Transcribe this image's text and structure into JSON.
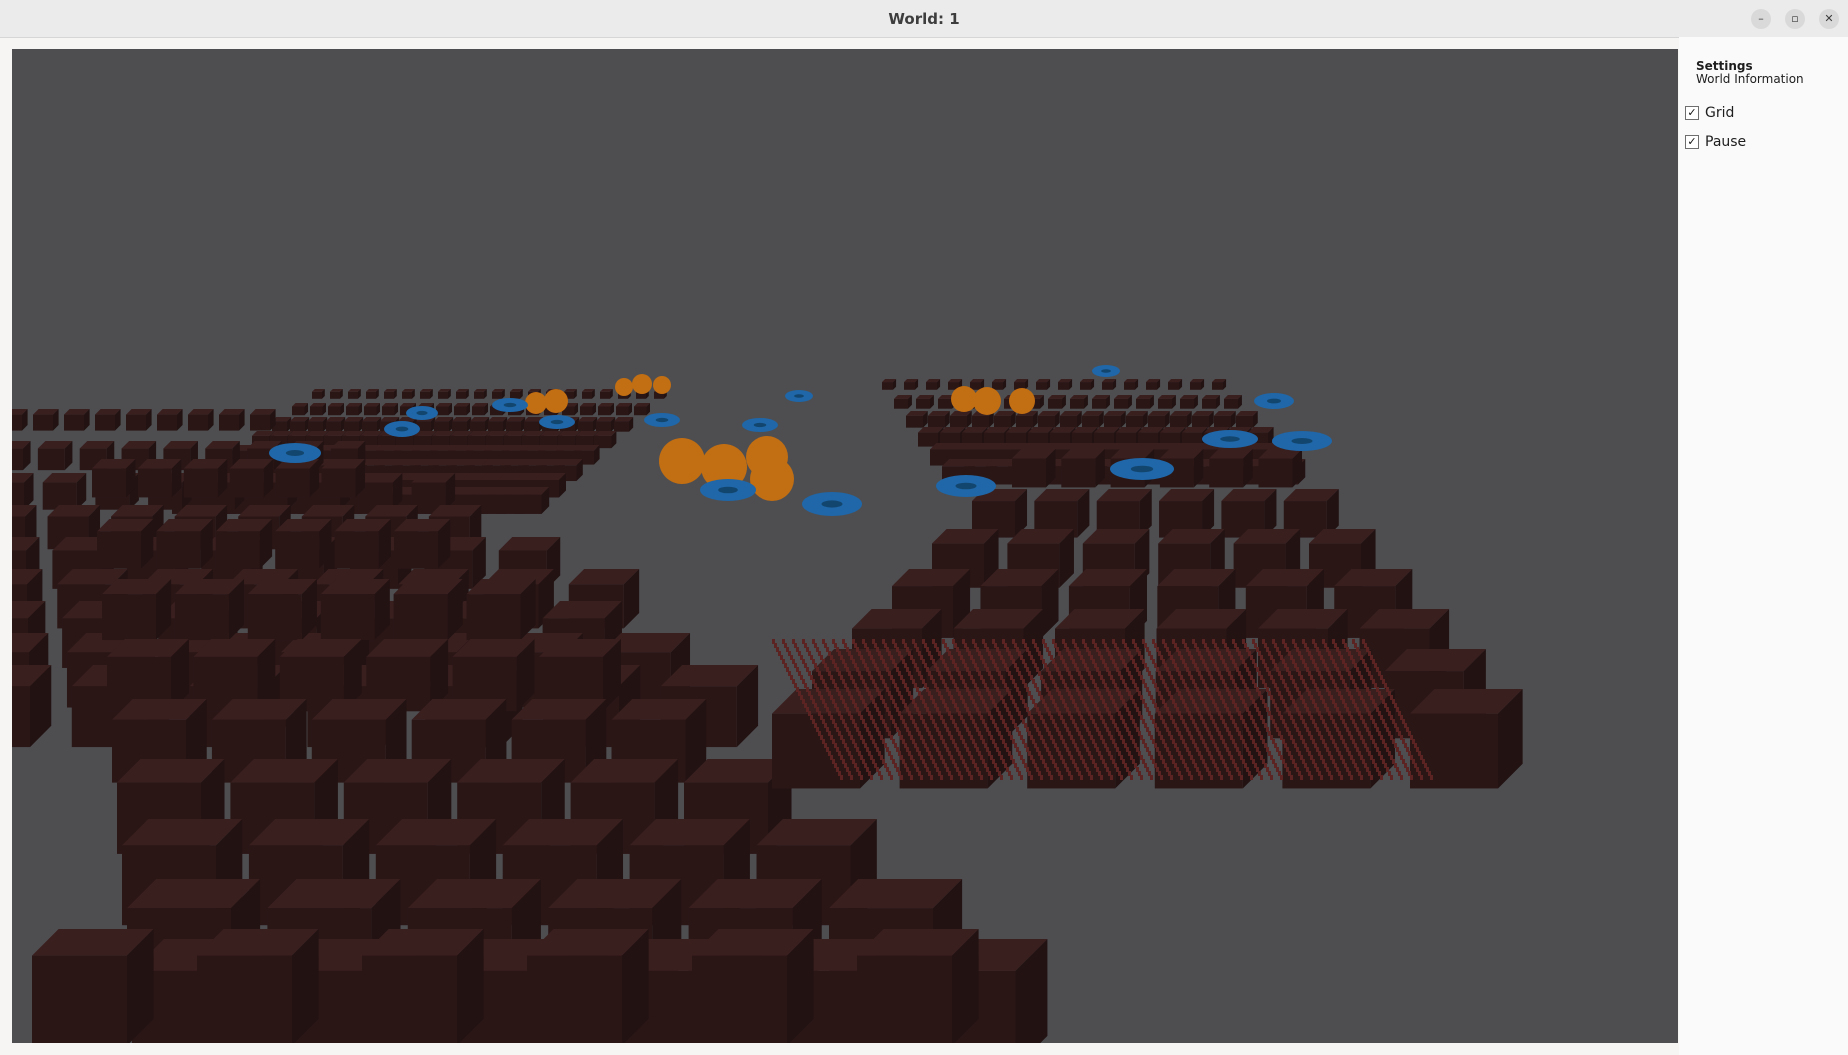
{
  "window": {
    "title": "World: 1",
    "minimize_glyph": "–",
    "maximize_glyph": "▫",
    "close_glyph": "✕"
  },
  "sidebar": {
    "heading": "Settings",
    "subheading": "World Information",
    "options": [
      {
        "label": "Grid",
        "checked": true,
        "glyph": "✓"
      },
      {
        "label": "Pause",
        "checked": true,
        "glyph": "✓"
      }
    ]
  },
  "scene": {
    "background_color": "#4e4e51",
    "block_colors": {
      "top": "#3a1f1f",
      "front": "#2b1616",
      "side": "#221212"
    },
    "sphere_color": "#c26e12",
    "torus_color": "#1f67a8"
  }
}
